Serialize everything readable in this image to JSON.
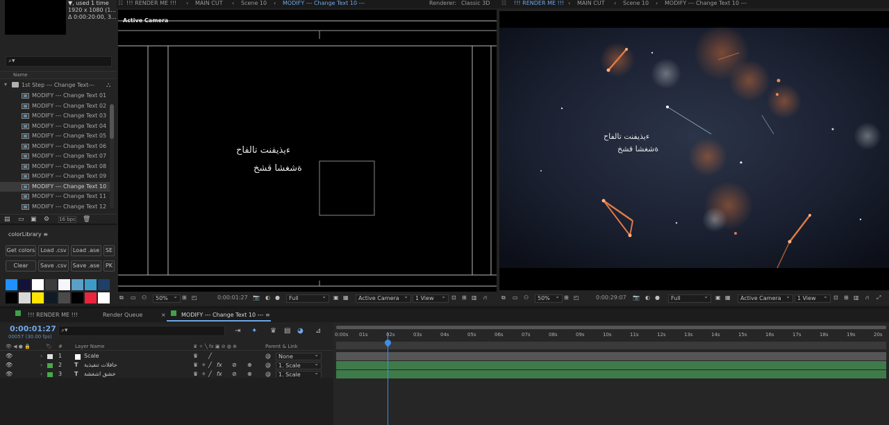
{
  "project": {
    "info_line1": "▼, used 1 time",
    "info_line2": "1920 x 1080 (1...",
    "info_line3": "Δ 0:00:20:00, 3...",
    "search_placeholder": "⌕▾",
    "column_name": "Name",
    "folder_name": "1st Step --- Change Text---",
    "items": [
      "MODIFY --- Change Text 01",
      "MODIFY --- Change Text 02",
      "MODIFY --- Change Text 03",
      "MODIFY --- Change Text 04",
      "MODIFY --- Change Text 05",
      "MODIFY --- Change Text 06",
      "MODIFY --- Change Text 07",
      "MODIFY --- Change Text 08",
      "MODIFY --- Change Text 09",
      "MODIFY --- Change Text 10",
      "MODIFY --- Change Text 11",
      "MODIFY --- Change Text 12"
    ],
    "selected_index": 9,
    "bpc": "16 bpc"
  },
  "color_library": {
    "title": "colorLibrary  ≡",
    "buttons_row1": [
      "Get colors",
      "Load .csv",
      "Load .ase",
      "SE"
    ],
    "buttons_row2": [
      "Clear",
      "Save .csv",
      "Save .ase",
      "PK"
    ],
    "swatches_row1": [
      "#1e90ff",
      "#12123a",
      "#ffffff",
      "#3c3c3c",
      "#f4f6fb",
      "#5aa0c8",
      "#3d9cc6",
      "#1f3f66"
    ],
    "swatches_row2": [
      "#000000",
      "#d9d9d9",
      "#ffe600",
      "#0f1a24",
      "#4a4a4a",
      "#000000",
      "#e8253c",
      "#ffffff"
    ]
  },
  "comp_panel": {
    "tabs": [
      "!!! RENDER ME !!!",
      "MAIN CUT",
      "Scene 10",
      "MODIFY --- Change Text 10 ---"
    ],
    "active_tab": 3,
    "renderer_label": "Renderer:",
    "renderer_value": "Classic 3D",
    "view_label": "Active Camera",
    "text_line1": "ءيذيفنت تالفاح",
    "text_line2": "ةشغشا قشخ",
    "zoom": "50%",
    "timecode": "0:00:01:27",
    "resolution": "Full",
    "camera": "Active Camera",
    "views": "1 View"
  },
  "preview_panel": {
    "tabs": [
      "!!! RENDER ME !!!",
      "MAIN CUT",
      "Scene 10",
      "MODIFY --- Change Text 10 ---"
    ],
    "active_tab": 0,
    "text_line1": "ءيذيفنت تالفاح",
    "text_line2": "ةشغشا قشخ",
    "zoom": "50%",
    "timecode": "0:00:29:07",
    "resolution": "Full",
    "camera": "Active Camera",
    "views": "1 View"
  },
  "timeline": {
    "tabs": [
      "!!! RENDER ME !!!",
      "Render Queue",
      "MODIFY --- Change Text 10 ---"
    ],
    "active_tab": 2,
    "timecode": "0:00:01:27",
    "fps": "00057 (30.00 fps)",
    "search_placeholder": "⌕▾",
    "header_layer_name": "Layer Name",
    "header_parent": "Parent & Link",
    "header_num": "#",
    "layers": [
      {
        "num": "1",
        "name": "Scale",
        "parent": "None",
        "label_color": "#e0e0e0",
        "type": "solid"
      },
      {
        "num": "2",
        "name": "حافلات تنفيذية",
        "parent": "1. Scale",
        "label_color": "#4aa84a",
        "type": "text"
      },
      {
        "num": "3",
        "name": "خشق اشغشة",
        "parent": "1. Scale",
        "label_color": "#4aa84a",
        "type": "text"
      }
    ],
    "ruler_ticks": [
      "0:00s",
      "01s",
      "02s",
      "03s",
      "04s",
      "05s",
      "06s",
      "07s",
      "08s",
      "09s",
      "10s",
      "11s",
      "12s",
      "13s",
      "14s",
      "15s",
      "16s",
      "17s",
      "18s",
      "19s",
      "20s"
    ],
    "playhead_seconds": 1.9,
    "duration_seconds": 20,
    "bar_colors": [
      "#555555",
      "#3f7a4a",
      "#3f7a4a"
    ]
  }
}
